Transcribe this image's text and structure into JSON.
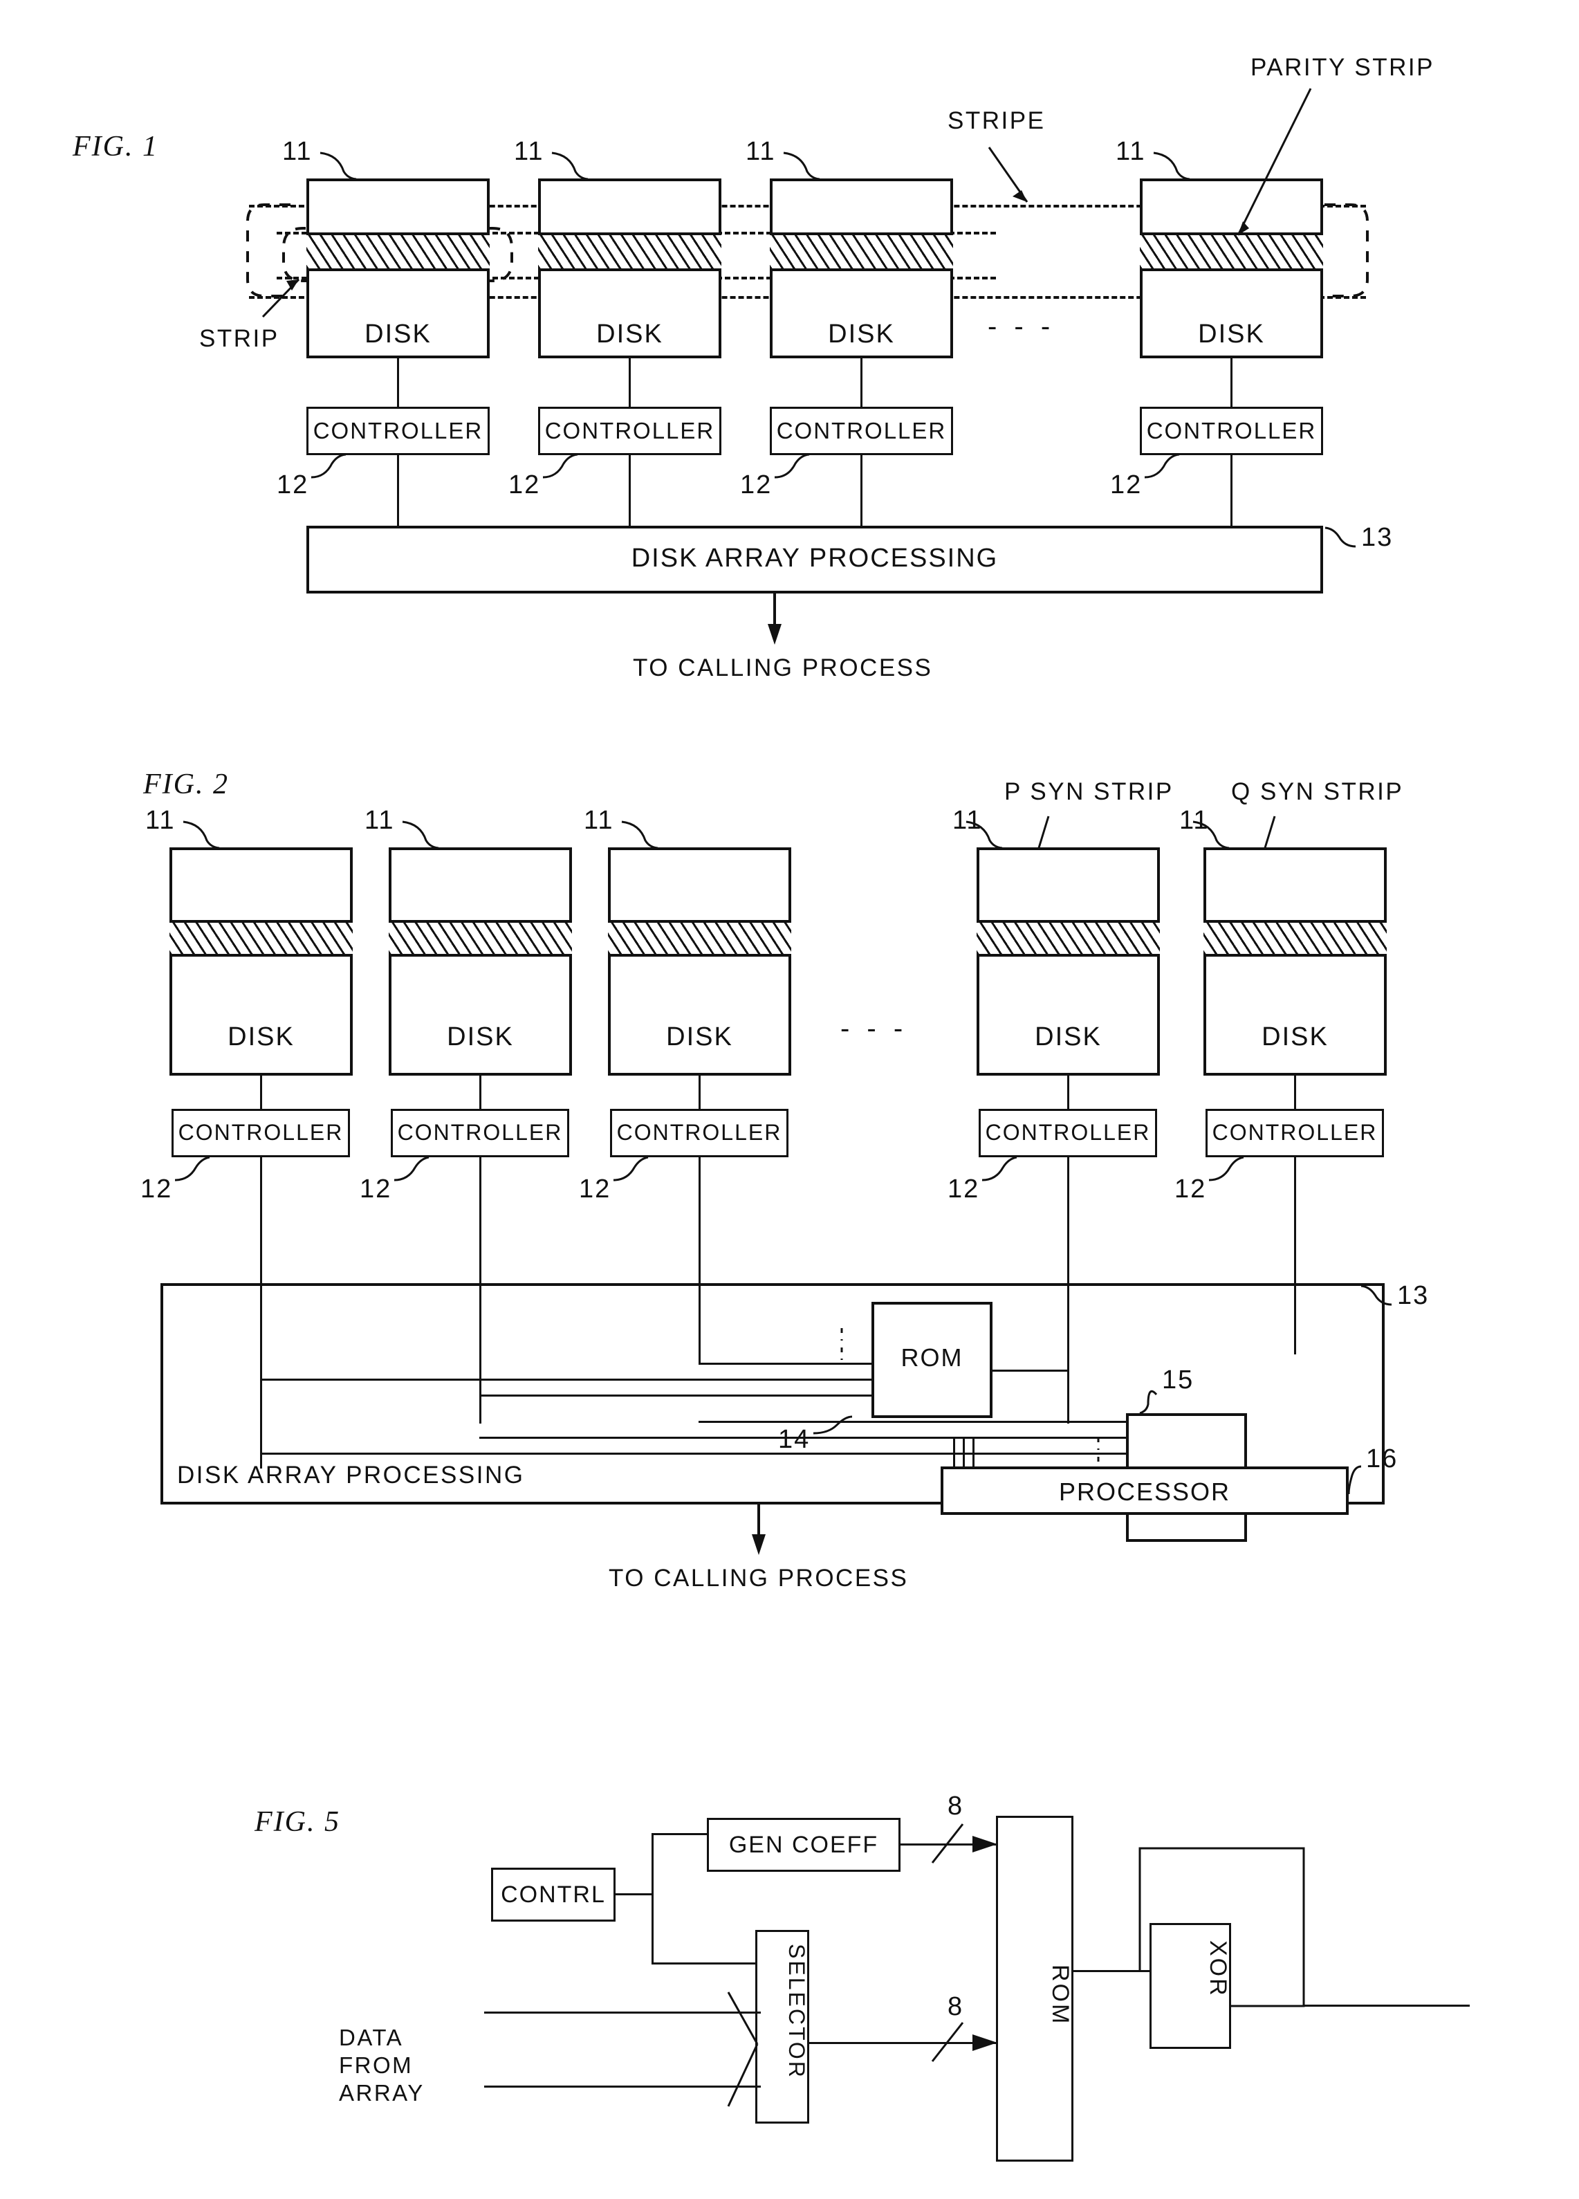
{
  "figures": [
    {
      "id": "fig1",
      "label": "FIG. 1",
      "callouts": {
        "strip": "STRIP",
        "stripe": "STRIPE",
        "parity_strip": "PARITY STRIP"
      },
      "disk_ref": "11",
      "controller_ref": "12",
      "processing_ref": "13",
      "disk_label": "DISK",
      "controller_label": "CONTROLLER",
      "processing_label": "DISK ARRAY PROCESSING",
      "output_label": "TO CALLING PROCESS",
      "ellipsis": "- - -",
      "disks": [
        {
          "name": "DISK",
          "ref": "11"
        },
        {
          "name": "DISK",
          "ref": "11"
        },
        {
          "name": "DISK",
          "ref": "11"
        },
        {
          "name": "DISK",
          "ref": "11"
        }
      ],
      "controllers": [
        {
          "name": "CONTROLLER",
          "ref": "12"
        },
        {
          "name": "CONTROLLER",
          "ref": "12"
        },
        {
          "name": "CONTROLLER",
          "ref": "12"
        },
        {
          "name": "CONTROLLER",
          "ref": "12"
        }
      ]
    },
    {
      "id": "fig2",
      "label": "FIG. 2",
      "callouts": {
        "p_syn_strip": "P SYN STRIP",
        "q_syn_strip": "Q SYN STRIP"
      },
      "disk_ref": "11",
      "controller_ref": "12",
      "processing_ref": "13",
      "rom1_ref": "14",
      "rom2_ref": "15",
      "processor_ref": "16",
      "disk_label": "DISK",
      "controller_label": "CONTROLLER",
      "processing_label": "DISK ARRAY PROCESSING",
      "rom_label": "ROM",
      "processor_label": "PROCESSOR",
      "output_label": "TO CALLING PROCESS",
      "ellipsis": "- - -",
      "disks": [
        {
          "name": "DISK",
          "ref": "11"
        },
        {
          "name": "DISK",
          "ref": "11"
        },
        {
          "name": "DISK",
          "ref": "11"
        },
        {
          "name": "DISK",
          "ref": "11"
        },
        {
          "name": "DISK",
          "ref": "11"
        }
      ],
      "controllers": [
        {
          "name": "CONTROLLER",
          "ref": "12"
        },
        {
          "name": "CONTROLLER",
          "ref": "12"
        },
        {
          "name": "CONTROLLER",
          "ref": "12"
        },
        {
          "name": "CONTROLLER",
          "ref": "12"
        },
        {
          "name": "CONTROLLER",
          "ref": "12"
        }
      ]
    },
    {
      "id": "fig5",
      "label": "FIG. 5",
      "contrl_label": "CONTRL",
      "gen_coeff_label": "GEN COEFF",
      "selector_label": "SELECTOR",
      "rom_label": "ROM",
      "xor_label": "XOR",
      "data_from_array_label": "DATA FROM ARRAY",
      "data_from_array_lines": [
        "DATA",
        "FROM",
        "ARRAY"
      ],
      "bus_width_top": "8",
      "bus_width_bottom": "8"
    }
  ]
}
